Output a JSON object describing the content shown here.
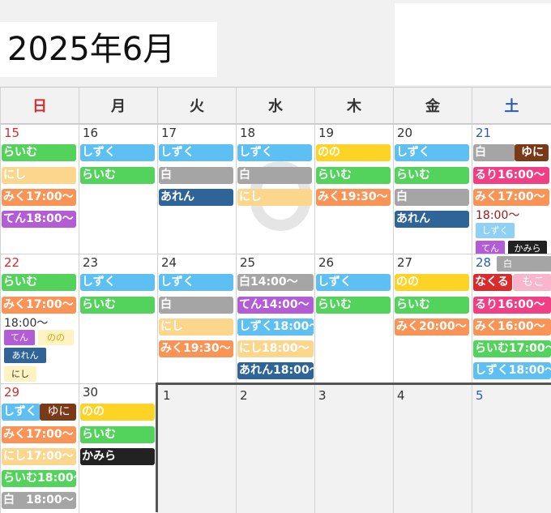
{
  "title": "2025年6月",
  "weekdays": [
    "日",
    "月",
    "火",
    "水",
    "木",
    "金",
    "土"
  ],
  "colors": {
    "sunday": "#d92b2b",
    "saturday": "#2b5db0",
    "default": "#333333"
  },
  "days": {
    "d15": "15",
    "d16": "16",
    "d17": "17",
    "d18": "18",
    "d19": "19",
    "d20": "20",
    "d21": "21",
    "d22": "22",
    "d23": "23",
    "d24": "24",
    "d25": "25",
    "d26": "26",
    "d27": "27",
    "d28": "28",
    "d29": "29",
    "d30": "30",
    "n1": "1",
    "n2": "2",
    "n3": "3",
    "n4": "4",
    "n5": "5"
  },
  "events": {
    "e15a": "らいむ",
    "e15b": "にし",
    "e15c": "みく17:00〜",
    "e15d": "てん18:00〜",
    "e16a": "しずく",
    "e16b": "らいむ",
    "e17a": "しずく",
    "e17b": "白",
    "e17c": "あれん",
    "e18a": "しずく",
    "e18b": "白",
    "e18c": "にし",
    "e19a": "のの",
    "e19b": "らいむ",
    "e19c": "みく19:30〜",
    "e20a": "しずく",
    "e20b": "らいむ",
    "e20c": "白",
    "e20d": "あれん",
    "e21a": "白",
    "e21b": "ゆに",
    "e21c": "るり16:00〜",
    "e21d": "みく17:00〜",
    "e21e": "18:00〜",
    "e21f": "しずく",
    "e21g": "てん",
    "e21h": "かみら",
    "e22a": "らいむ",
    "e22b": "みく17:00〜",
    "e22c": "18:00〜",
    "e22d": "てん",
    "e22e": "のの",
    "e22f": "あれん",
    "e22g": "にし",
    "e23a": "しずく",
    "e23b": "らいむ",
    "e24a": "しずく",
    "e24b": "白",
    "e24c": "にし",
    "e24d": "みく19:30〜",
    "e25a": "白14:00〜",
    "e25b": "てん14:00〜",
    "e25c": "しずく18:00〜",
    "e25d": "にし18:00〜",
    "e25e": "あれん18:00〜",
    "e26a": "しずく",
    "e26b": "らいむ",
    "e27a": "のの",
    "e27b": "らいむ",
    "e27c": "みく20:00〜",
    "e28a": "白",
    "e28b": "なくる",
    "e28c": "もこ",
    "e28d": "るり16:00〜",
    "e28e": "みく16:00〜",
    "e28f": "らいむ17:00〜",
    "e28g": "しずく18:00〜",
    "e29a": "しずく",
    "e29b": "ゆに",
    "e29c": "みく17:00〜",
    "e29d": "にし17:00〜",
    "e29e": "らいむ18:00〜",
    "e29f": "白　18:00〜",
    "e30a": "のの",
    "e30b": "らいむ",
    "e30c": "かみら"
  }
}
